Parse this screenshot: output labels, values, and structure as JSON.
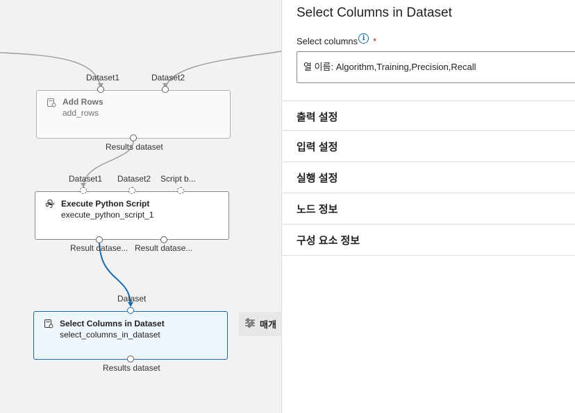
{
  "canvas": {
    "nodes": [
      {
        "key": "add_rows",
        "title": "Add Rows",
        "subtitle": "add_rows",
        "inputs": [
          "Dataset1",
          "Dataset2"
        ],
        "outputs": [
          "Results dataset"
        ],
        "icon": "dataset-module-icon"
      },
      {
        "key": "execute_python_script",
        "title": "Execute Python Script",
        "subtitle": "execute_python_script_1",
        "inputs": [
          "Dataset1",
          "Dataset2",
          "Script b..."
        ],
        "outputs": [
          "Result datase...",
          "Result datase..."
        ],
        "icon": "python-icon"
      },
      {
        "key": "select_columns",
        "title": "Select Columns in Dataset",
        "subtitle": "select_columns_in_dataset",
        "inputs": [
          "Dataset"
        ],
        "outputs": [
          "Results dataset"
        ],
        "icon": "dataset-module-icon"
      }
    ],
    "params_tab": {
      "label": "매개",
      "icon": "sliders-icon"
    },
    "colors": {
      "selected_edge": "#0f6cbd",
      "edge": "#a19f9d"
    }
  },
  "panel": {
    "title": "Select Columns in Dataset",
    "field": {
      "label": "Select columns",
      "required_mark": "*",
      "info_glyph": "i",
      "value": "열 이름: Algorithm,Training,Precision,Recall"
    },
    "sections": [
      "출력 설정",
      "입력 설정",
      "실행 설정",
      "노드 정보",
      "구성 요소 정보"
    ]
  }
}
